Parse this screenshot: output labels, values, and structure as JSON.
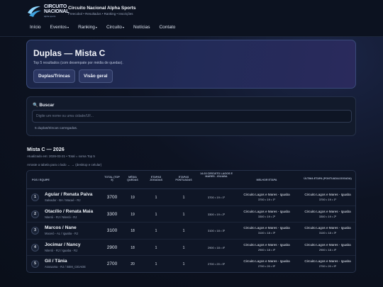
{
  "brand": {
    "logo_line1": "CIRCUITO",
    "logo_line2": "NACIONAL",
    "logo_line3": "alpha sports",
    "title": "Circuito Nacional Alpha Sports",
    "subtitle": "Freecobol • Resultados • Ranking • Inscrições"
  },
  "nav": [
    {
      "label": "Início",
      "caret": ""
    },
    {
      "label": "Eventos",
      "caret": "▾"
    },
    {
      "label": "Ranking",
      "caret": "▾"
    },
    {
      "label": "Circuito",
      "caret": "▾"
    },
    {
      "label": "Notícias",
      "caret": ""
    },
    {
      "label": "Contato",
      "caret": ""
    }
  ],
  "hero": {
    "title": "Duplas — Mista C",
    "subtitle": "Top 5 resultados (com desempate por média de quedas).",
    "btn_duplas": "Duplas/Trincas",
    "btn_visao": "Visão geral"
  },
  "search": {
    "title": "🔍 Buscar",
    "placeholder": "Digite um nome ou uma cidade/UF...",
    "status": "5 duplas/trincas carregadas."
  },
  "section": {
    "title": "Mista C — 2026",
    "meta": "Atualizado em: 2026-03-21 • Total = soma Top 5",
    "hint": "Arraste a tabela para o lado ← → (desktop e celular)"
  },
  "table": {
    "headers": {
      "pos": "POS / EQUIPE",
      "total": "TOTAL (TOP 5)",
      "media": "MÉDIA QUEDAS",
      "jogadas": "ETAPAS JOGADAS",
      "pontuadas": "ETAPAS PONTUADAS",
      "etapa": "14-03 CIRCUITO LAGOS E MARES - IGUABA",
      "melhor": "MELHOR ETAPA",
      "ultima": "ÚLTIMA ETAPA (PONTUADA/JOGADA)"
    },
    "rows": [
      {
        "pos": "1",
        "name": "Aguiar / Renata Paiva",
        "city": "Salvador - BA / Macaé - RJ",
        "total": "3700",
        "media": "19",
        "jogadas": "1",
        "pontuadas": "1",
        "etapa": "3700 • 19 • 1º",
        "best_name": "Circuito Lagos e Mares - Iguaba",
        "best_val": "3700 • 19 • 1º",
        "last_name": "Circuito Lagos e Mares - Iguaba",
        "last_val": "3700 • 19 • 1º"
      },
      {
        "pos": "2",
        "name": "Otacílio / Renata Maia",
        "city": "Niterói - RJ / Niterói - RJ",
        "total": "3300",
        "media": "19",
        "jogadas": "1",
        "pontuadas": "1",
        "etapa": "3300 • 19 • 2º",
        "best_name": "Circuito Lagos e Mares - Iguaba",
        "best_val": "3300 • 19 • 2º",
        "last_name": "Circuito Lagos e Mares - Iguaba",
        "last_val": "3300 • 19 • 2º"
      },
      {
        "pos": "3",
        "name": "Marcos / Nane",
        "city": "Maceió - AL / Iguaba - RJ",
        "total": "3100",
        "media": "18",
        "jogadas": "1",
        "pontuadas": "1",
        "etapa": "3100 • 18 • 3º",
        "best_name": "Circuito Lagos e Mares - Iguaba",
        "best_val": "3100 • 18 • 3º",
        "last_name": "Circuito Lagos e Mares - Iguaba",
        "last_val": "3100 • 18 • 3º"
      },
      {
        "pos": "4",
        "name": "Jocimar / Nancy",
        "city": "Niterói - RJ / Iguaba - RJ",
        "total": "2900",
        "media": "18",
        "jogadas": "1",
        "pontuadas": "1",
        "etapa": "2900 • 18 • 4º",
        "best_name": "Circuito Lagos e Mares - Iguaba",
        "best_val": "2900 • 18 • 4º",
        "last_name": "Circuito Lagos e Mares - Iguaba",
        "last_val": "2900 • 18 • 4º"
      },
      {
        "pos": "5",
        "name": "Gil / Tânia",
        "city": "Araruama - RJ / SEM_CIDADE",
        "total": "2700",
        "media": "20",
        "jogadas": "1",
        "pontuadas": "1",
        "etapa": "2700 • 20 • 5º",
        "best_name": "Circuito Lagos e Mares - Iguaba",
        "best_val": "2700 • 20 • 5º",
        "last_name": "Circuito Lagos e Mares - Iguaba",
        "last_val": "2700 • 20 • 5º"
      }
    ]
  }
}
